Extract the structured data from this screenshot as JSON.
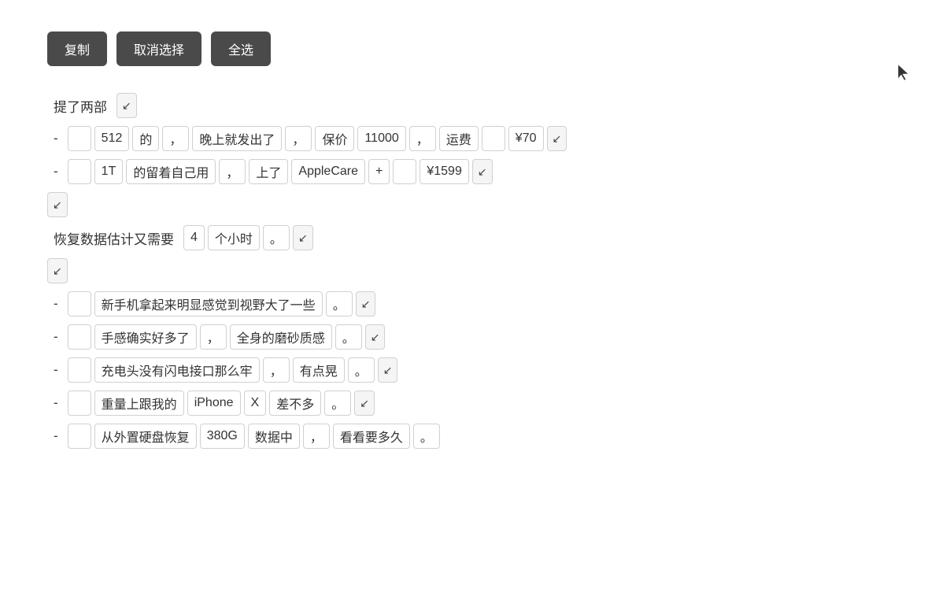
{
  "toolbar": {
    "copy_label": "复制",
    "deselect_label": "取消选择",
    "select_all_label": "全选"
  },
  "lines": [
    {
      "type": "heading",
      "tokens": [
        {
          "text": "提了两部",
          "style": "plain"
        },
        {
          "text": "↙",
          "style": "arrow"
        }
      ]
    },
    {
      "type": "bullet",
      "tokens": [
        {
          "text": "-",
          "style": "plain"
        },
        {
          "text": "",
          "style": "token-empty"
        },
        {
          "text": "512",
          "style": "token"
        },
        {
          "text": "的",
          "style": "token"
        },
        {
          "text": "，",
          "style": "token"
        },
        {
          "text": "晚上就发出了",
          "style": "token"
        },
        {
          "text": "，",
          "style": "token"
        },
        {
          "text": "保价",
          "style": "token"
        },
        {
          "text": "11000",
          "style": "token"
        },
        {
          "text": "，",
          "style": "token"
        },
        {
          "text": "运费",
          "style": "token"
        },
        {
          "text": "",
          "style": "token-empty"
        },
        {
          "text": "¥70",
          "style": "token"
        },
        {
          "text": "↙",
          "style": "arrow"
        }
      ]
    },
    {
      "type": "bullet",
      "tokens": [
        {
          "text": "-",
          "style": "plain"
        },
        {
          "text": "",
          "style": "token-empty"
        },
        {
          "text": "1T",
          "style": "token"
        },
        {
          "text": "的留着自己用",
          "style": "token"
        },
        {
          "text": "，",
          "style": "token"
        },
        {
          "text": "上了",
          "style": "token"
        },
        {
          "text": "AppleCare",
          "style": "token"
        },
        {
          "text": "+",
          "style": "token"
        },
        {
          "text": "",
          "style": "token-empty"
        },
        {
          "text": "¥1599",
          "style": "token"
        },
        {
          "text": "↙",
          "style": "arrow"
        }
      ]
    },
    {
      "type": "standalone-arrow",
      "tokens": [
        {
          "text": "↙",
          "style": "arrow"
        }
      ]
    },
    {
      "type": "normal",
      "tokens": [
        {
          "text": "恢复数据估计又需要",
          "style": "plain"
        },
        {
          "text": "4",
          "style": "token"
        },
        {
          "text": "个小时",
          "style": "token"
        },
        {
          "text": "。",
          "style": "token"
        },
        {
          "text": "↙",
          "style": "arrow"
        }
      ]
    },
    {
      "type": "standalone-arrow",
      "tokens": [
        {
          "text": "↙",
          "style": "arrow"
        }
      ]
    },
    {
      "type": "bullet",
      "tokens": [
        {
          "text": "-",
          "style": "plain"
        },
        {
          "text": "",
          "style": "token-empty"
        },
        {
          "text": "新手机拿起来明显感觉到视野大了一些",
          "style": "token"
        },
        {
          "text": "。",
          "style": "token"
        },
        {
          "text": "↙",
          "style": "arrow"
        }
      ]
    },
    {
      "type": "bullet",
      "tokens": [
        {
          "text": "-",
          "style": "plain"
        },
        {
          "text": "",
          "style": "token-empty"
        },
        {
          "text": "手感确实好多了",
          "style": "token"
        },
        {
          "text": "，",
          "style": "token"
        },
        {
          "text": "全身的磨砂质感",
          "style": "token"
        },
        {
          "text": "。",
          "style": "token"
        },
        {
          "text": "↙",
          "style": "arrow"
        }
      ]
    },
    {
      "type": "bullet",
      "tokens": [
        {
          "text": "-",
          "style": "plain"
        },
        {
          "text": "",
          "style": "token-empty"
        },
        {
          "text": "充电头没有闪电接口那么牢",
          "style": "token"
        },
        {
          "text": "，",
          "style": "token"
        },
        {
          "text": "有点晃",
          "style": "token"
        },
        {
          "text": "。",
          "style": "token"
        },
        {
          "text": "↙",
          "style": "arrow"
        }
      ]
    },
    {
      "type": "bullet",
      "tokens": [
        {
          "text": "-",
          "style": "plain"
        },
        {
          "text": "",
          "style": "token-empty"
        },
        {
          "text": "重量上跟我的",
          "style": "token"
        },
        {
          "text": "iPhone",
          "style": "token"
        },
        {
          "text": "X",
          "style": "token"
        },
        {
          "text": "差不多",
          "style": "token"
        },
        {
          "text": "。",
          "style": "token"
        },
        {
          "text": "↙",
          "style": "arrow"
        }
      ]
    },
    {
      "type": "bullet",
      "tokens": [
        {
          "text": "-",
          "style": "plain"
        },
        {
          "text": "",
          "style": "token-empty"
        },
        {
          "text": "从外置硬盘恢复",
          "style": "token"
        },
        {
          "text": "380G",
          "style": "token"
        },
        {
          "text": "数据中",
          "style": "token"
        },
        {
          "text": "，",
          "style": "token"
        },
        {
          "text": "看看要多久",
          "style": "token"
        },
        {
          "text": "。",
          "style": "token"
        }
      ]
    }
  ]
}
